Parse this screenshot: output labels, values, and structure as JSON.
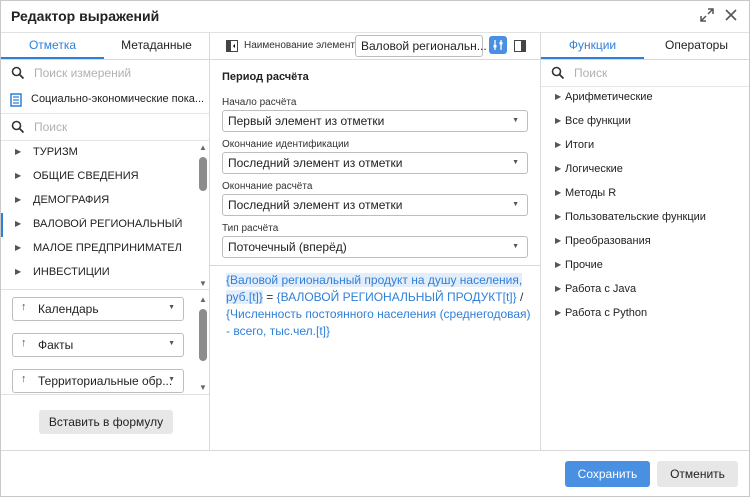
{
  "window": {
    "title": "Редактор выражений"
  },
  "left": {
    "tabs": [
      {
        "label": "Отметка",
        "active": true
      },
      {
        "label": "Метаданные",
        "active": false
      }
    ],
    "search_measures": {
      "placeholder": "Поиск измерений"
    },
    "source": {
      "label": "Социально-экономические пока..."
    },
    "search": {
      "placeholder": "Поиск"
    },
    "tree": [
      {
        "label": "ТУРИЗМ"
      },
      {
        "label": "ОБЩИЕ СВЕДЕНИЯ"
      },
      {
        "label": "ДЕМОГРАФИЯ"
      },
      {
        "label": "ВАЛОВОЙ РЕГИОНАЛЬНЫЙ ..."
      },
      {
        "label": "МАЛОЕ ПРЕДПРИНИМАТЕЛ..."
      },
      {
        "label": "ИНВЕСТИЦИИ"
      }
    ],
    "dimensions": [
      {
        "label": "Календарь"
      },
      {
        "label": "Факты"
      },
      {
        "label": "Территориальные обр..."
      }
    ],
    "insert_button": "Вставить в формулу"
  },
  "middle": {
    "element_name_label": "Наименование элемента:",
    "element_name_value": "Валовой региональн...",
    "section_title": "Период расчёта",
    "fields": [
      {
        "label": "Начало расчёта",
        "value": "Первый элемент из отметки"
      },
      {
        "label": "Окончание идентификации",
        "value": "Последний элемент из отметки"
      },
      {
        "label": "Окончание расчёта",
        "value": "Последний элемент из отметки"
      },
      {
        "label": "Тип расчёта",
        "value": "Поточечный (вперёд)"
      }
    ],
    "formula": {
      "part1": "{Валовой региональный продукт на душу населения, руб.[t]}",
      "op1": " = ",
      "part2": "{ВАЛОВОЙ РЕГИОНАЛЬНЫЙ ПРОДУКТ[t]}",
      "op2": " / ",
      "part3": "{Численность постоянного населения (среднегодовая) - всего, тыс.чел.[t]}"
    }
  },
  "right": {
    "tabs": [
      {
        "label": "Функции",
        "active": true
      },
      {
        "label": "Операторы",
        "active": false
      }
    ],
    "search": {
      "placeholder": "Поиск"
    },
    "functions": [
      {
        "label": "Арифметические"
      },
      {
        "label": "Все функции"
      },
      {
        "label": "Итоги"
      },
      {
        "label": "Логические"
      },
      {
        "label": "Методы R"
      },
      {
        "label": "Пользовательские функции"
      },
      {
        "label": "Преобразования"
      },
      {
        "label": "Прочие"
      },
      {
        "label": "Работа с Java"
      },
      {
        "label": "Работа с Python"
      }
    ]
  },
  "footer": {
    "save_label": "Сохранить",
    "cancel_label": "Отменить"
  },
  "colors": {
    "accent": "#2f7fd8",
    "primary_button": "#4a90e2",
    "secondary_button": "#e7e7e7",
    "formula_highlight": "#e4eefb"
  }
}
